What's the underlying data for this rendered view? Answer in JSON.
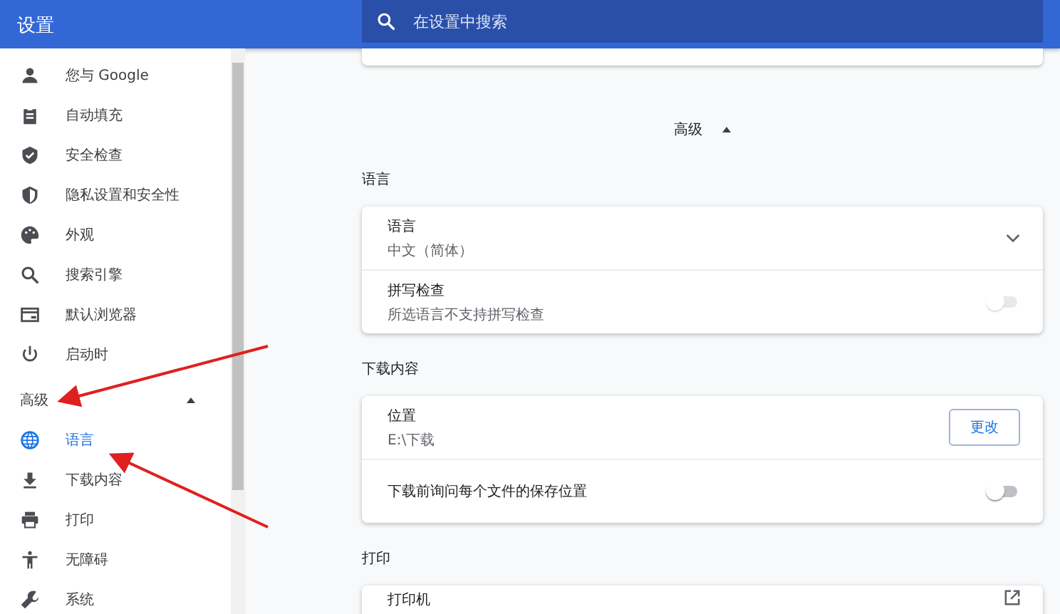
{
  "header": {
    "title": "设置"
  },
  "search": {
    "placeholder": "在设置中搜索"
  },
  "sidebar": {
    "items": [
      {
        "label": "您与 Google",
        "selected": false
      },
      {
        "label": "自动填充",
        "selected": false
      },
      {
        "label": "安全检查",
        "selected": false
      },
      {
        "label": "隐私设置和安全性",
        "selected": false
      },
      {
        "label": "外观",
        "selected": false
      },
      {
        "label": "搜索引擎",
        "selected": false
      },
      {
        "label": "默认浏览器",
        "selected": false
      },
      {
        "label": "启动时",
        "selected": false
      }
    ],
    "advanced": {
      "label": "高级",
      "expanded": true
    },
    "advanced_items": [
      {
        "label": "语言",
        "selected": true
      },
      {
        "label": "下载内容",
        "selected": false
      },
      {
        "label": "打印",
        "selected": false
      },
      {
        "label": "无障碍",
        "selected": false
      },
      {
        "label": "系统",
        "selected": false
      }
    ]
  },
  "advanced_toggle": {
    "label": "高级",
    "expanded": true
  },
  "sections": [
    {
      "title": "语言",
      "rows": [
        {
          "kind": "dropdown",
          "label": "语言",
          "value": "中文（简体）",
          "expanded": false
        },
        {
          "kind": "toggle",
          "label": "拼写检查",
          "value": "所选语言不支持拼写检查",
          "on": false,
          "disabled": true
        }
      ]
    },
    {
      "title": "下载内容",
      "rows": [
        {
          "kind": "button",
          "label": "位置",
          "value": "E:\\下载",
          "button": "更改"
        },
        {
          "kind": "toggle",
          "label": "下载前询问每个文件的保存位置",
          "on": false,
          "disabled": false
        }
      ]
    },
    {
      "title": "打印",
      "rows": [
        {
          "kind": "link",
          "label": "打印机"
        }
      ]
    }
  ]
}
